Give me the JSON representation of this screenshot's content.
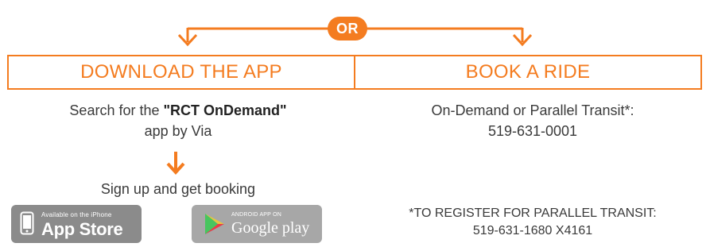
{
  "colors": {
    "accent": "#f47c20",
    "text": "#3a3a3a",
    "badge_dark": "#8b8b8b",
    "badge_light": "#a7a7a7"
  },
  "or_badge": "OR",
  "left": {
    "header": "DOWNLOAD THE APP",
    "search_prefix": "Search for the ",
    "app_name": "\"RCT OnDemand\"",
    "search_suffix": "app by Via",
    "signup_text": "Sign up and get booking",
    "app_store": {
      "small": "Available on the iPhone",
      "big": "App Store",
      "icon": "iphone-icon"
    },
    "google_play": {
      "small": "ANDROID APP ON",
      "big": "Google play",
      "icon": "play-triangle-icon"
    }
  },
  "right": {
    "header": "BOOK A RIDE",
    "service_label": "On-Demand or Parallel Transit*:",
    "service_phone": "519-631-0001",
    "register_label": "*TO REGISTER FOR PARALLEL TRANSIT:",
    "register_phone": "519-631-1680 X4161"
  }
}
